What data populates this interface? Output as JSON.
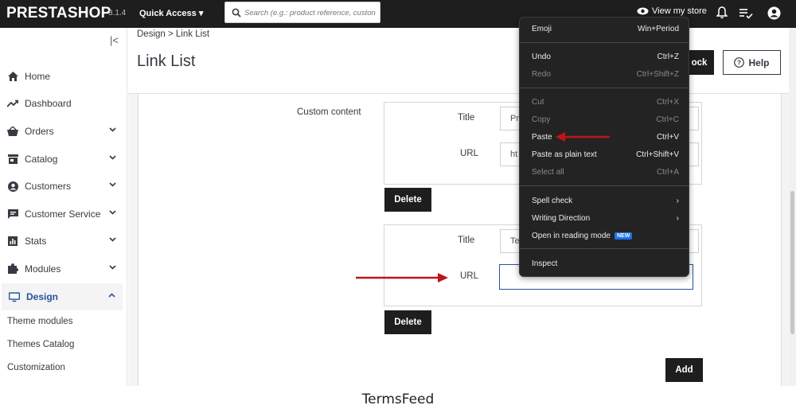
{
  "topbar": {
    "brand": "PRESTASHOP",
    "version": "8.1.4",
    "quick_access": "Quick Access",
    "search_placeholder": "Search (e.g.: product reference, custon",
    "view_store": "View my store"
  },
  "sidebar": {
    "items": [
      {
        "label": "Home",
        "icon": "home-icon"
      },
      {
        "label": "Dashboard",
        "icon": "trending-up-icon"
      },
      {
        "label": "Orders",
        "icon": "basket-icon"
      },
      {
        "label": "Catalog",
        "icon": "store-icon"
      },
      {
        "label": "Customers",
        "icon": "account-circle-icon"
      },
      {
        "label": "Customer Service",
        "icon": "chat-icon"
      },
      {
        "label": "Stats",
        "icon": "bar-chart-icon"
      },
      {
        "label": "Modules",
        "icon": "puzzle-icon"
      },
      {
        "label": "Design",
        "icon": "desktop-icon"
      }
    ],
    "sub_items": [
      "Theme modules",
      "Themes Catalog",
      "Customization"
    ]
  },
  "header": {
    "breadcrumb": "Design > Link List",
    "title": "Link List",
    "partial_button": "ock",
    "help": "Help"
  },
  "form": {
    "custom_content_label": "Custom content",
    "link1": {
      "title_label": "Title",
      "title_value": "Pr",
      "url_label": "URL",
      "url_value": "ht"
    },
    "link2": {
      "title_label": "Title",
      "title_value": "Te",
      "url_label": "URL",
      "url_value": ""
    },
    "delete": "Delete",
    "add": "Add"
  },
  "context_menu": {
    "emoji": {
      "label": "Emoji",
      "shortcut": "Win+Period"
    },
    "undo": {
      "label": "Undo",
      "shortcut": "Ctrl+Z"
    },
    "redo": {
      "label": "Redo",
      "shortcut": "Ctrl+Shift+Z"
    },
    "cut": {
      "label": "Cut",
      "shortcut": "Ctrl+X"
    },
    "copy": {
      "label": "Copy",
      "shortcut": "Ctrl+C"
    },
    "paste": {
      "label": "Paste",
      "shortcut": "Ctrl+V"
    },
    "paste_plain": {
      "label": "Paste as plain text",
      "shortcut": "Ctrl+Shift+V"
    },
    "select_all": {
      "label": "Select all",
      "shortcut": "Ctrl+A"
    },
    "spell_check": "Spell check",
    "writing_direction": "Writing Direction",
    "reading_mode": "Open in reading mode",
    "new_badge": "NEW",
    "inspect": "Inspect"
  },
  "footer": {
    "watermark": "TermsFeed"
  },
  "colors": {
    "topbar": "#1e1e1e",
    "accent": "#25549b",
    "arrow": "#c0141b",
    "menu_bg": "#232323"
  }
}
